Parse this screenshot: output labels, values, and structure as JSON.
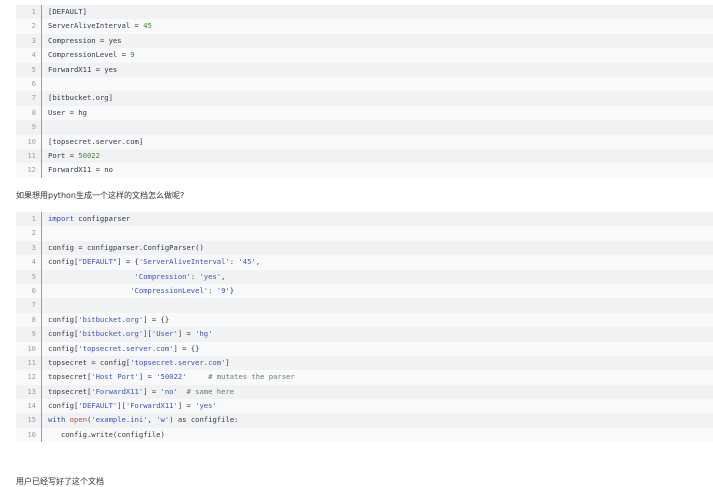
{
  "block1": {
    "lines": [
      {
        "num": "1",
        "segments": [
          {
            "t": "[DEFAULT]",
            "c": ""
          }
        ]
      },
      {
        "num": "2",
        "segments": [
          {
            "t": "ServerAliveInterval = ",
            "c": ""
          },
          {
            "t": "45",
            "c": "tok-num"
          }
        ]
      },
      {
        "num": "3",
        "segments": [
          {
            "t": "Compression = yes",
            "c": ""
          }
        ]
      },
      {
        "num": "4",
        "segments": [
          {
            "t": "CompressionLevel = ",
            "c": ""
          },
          {
            "t": "9",
            "c": "tok-num"
          }
        ]
      },
      {
        "num": "5",
        "segments": [
          {
            "t": "ForwardX11 = yes",
            "c": ""
          }
        ]
      },
      {
        "num": "6",
        "segments": [
          {
            "t": "",
            "c": ""
          }
        ]
      },
      {
        "num": "7",
        "segments": [
          {
            "t": "[bitbucket.org]",
            "c": ""
          }
        ]
      },
      {
        "num": "8",
        "segments": [
          {
            "t": "User = hg",
            "c": ""
          }
        ]
      },
      {
        "num": "9",
        "segments": [
          {
            "t": "",
            "c": ""
          }
        ]
      },
      {
        "num": "10",
        "segments": [
          {
            "t": "[topsecret.server.com]",
            "c": ""
          }
        ]
      },
      {
        "num": "11",
        "segments": [
          {
            "t": "Port = ",
            "c": ""
          },
          {
            "t": "50022",
            "c": "tok-num"
          }
        ]
      },
      {
        "num": "12",
        "segments": [
          {
            "t": "ForwardX11 = no",
            "c": ""
          }
        ]
      }
    ]
  },
  "question": "如果想用python生成一个这样的文档怎么做呢?",
  "block2": {
    "lines": [
      {
        "num": "1",
        "segments": [
          {
            "t": "import",
            "c": "tok-kw"
          },
          {
            "t": " configparser",
            "c": ""
          }
        ]
      },
      {
        "num": "2",
        "segments": [
          {
            "t": "",
            "c": ""
          }
        ]
      },
      {
        "num": "3",
        "segments": [
          {
            "t": "config = configparser.ConfigParser()",
            "c": ""
          }
        ]
      },
      {
        "num": "4",
        "segments": [
          {
            "t": "config[",
            "c": ""
          },
          {
            "t": "\"DEFAULT\"",
            "c": "tok-str2"
          },
          {
            "t": "] = {",
            "c": ""
          },
          {
            "t": "'ServerAliveInterval'",
            "c": "tok-str2"
          },
          {
            "t": ": ",
            "c": ""
          },
          {
            "t": "'45'",
            "c": "tok-str2"
          },
          {
            "t": ",",
            "c": ""
          }
        ]
      },
      {
        "num": "5",
        "segments": [
          {
            "t": "                    ",
            "c": ""
          },
          {
            "t": "'Compression'",
            "c": "tok-str2"
          },
          {
            "t": ": ",
            "c": ""
          },
          {
            "t": "'yes'",
            "c": "tok-str2"
          },
          {
            "t": ",",
            "c": ""
          }
        ]
      },
      {
        "num": "6",
        "segments": [
          {
            "t": "                   ",
            "c": ""
          },
          {
            "t": "'CompressionLevel'",
            "c": "tok-str2"
          },
          {
            "t": ": ",
            "c": ""
          },
          {
            "t": "'9'",
            "c": "tok-str2"
          },
          {
            "t": "}",
            "c": ""
          }
        ]
      },
      {
        "num": "7",
        "segments": [
          {
            "t": "",
            "c": ""
          }
        ]
      },
      {
        "num": "8",
        "segments": [
          {
            "t": "config[",
            "c": ""
          },
          {
            "t": "'bitbucket.org'",
            "c": "tok-str2"
          },
          {
            "t": "] = {}",
            "c": ""
          }
        ]
      },
      {
        "num": "9",
        "segments": [
          {
            "t": "config[",
            "c": ""
          },
          {
            "t": "'bitbucket.org'",
            "c": "tok-str2"
          },
          {
            "t": "][",
            "c": ""
          },
          {
            "t": "'User'",
            "c": "tok-str2"
          },
          {
            "t": "] = ",
            "c": ""
          },
          {
            "t": "'hg'",
            "c": "tok-str2"
          }
        ]
      },
      {
        "num": "10",
        "segments": [
          {
            "t": "config[",
            "c": ""
          },
          {
            "t": "'topsecret.server.com'",
            "c": "tok-str2"
          },
          {
            "t": "] = {}",
            "c": ""
          }
        ]
      },
      {
        "num": "11",
        "segments": [
          {
            "t": "topsecret = config[",
            "c": ""
          },
          {
            "t": "'topsecret.server.com'",
            "c": "tok-str2"
          },
          {
            "t": "]",
            "c": ""
          }
        ]
      },
      {
        "num": "12",
        "segments": [
          {
            "t": "topsecret[",
            "c": ""
          },
          {
            "t": "'Host Port'",
            "c": "tok-str2"
          },
          {
            "t": "] = ",
            "c": ""
          },
          {
            "t": "'50022'",
            "c": "tok-str2"
          },
          {
            "t": "     ",
            "c": ""
          },
          {
            "t": "# mutates the parser",
            "c": "tok-comment"
          }
        ]
      },
      {
        "num": "13",
        "segments": [
          {
            "t": "topsecret[",
            "c": ""
          },
          {
            "t": "'ForwardX11'",
            "c": "tok-str2"
          },
          {
            "t": "] = ",
            "c": ""
          },
          {
            "t": "'no'",
            "c": "tok-str2"
          },
          {
            "t": "  ",
            "c": ""
          },
          {
            "t": "# same here",
            "c": "tok-comment"
          }
        ]
      },
      {
        "num": "14",
        "segments": [
          {
            "t": "config[",
            "c": ""
          },
          {
            "t": "'DEFAULT'",
            "c": "tok-str2"
          },
          {
            "t": "][",
            "c": ""
          },
          {
            "t": "'ForwardX11'",
            "c": "tok-str2"
          },
          {
            "t": "] = ",
            "c": ""
          },
          {
            "t": "'yes'",
            "c": "tok-str2"
          }
        ]
      },
      {
        "num": "15",
        "segments": [
          {
            "t": "with",
            "c": "tok-kw"
          },
          {
            "t": " ",
            "c": ""
          },
          {
            "t": "open",
            "c": "tok-builtin"
          },
          {
            "t": "(",
            "c": ""
          },
          {
            "t": "'example.ini'",
            "c": "tok-str2"
          },
          {
            "t": ", ",
            "c": ""
          },
          {
            "t": "'w'",
            "c": "tok-str2"
          },
          {
            "t": ") as configfile:",
            "c": ""
          }
        ]
      },
      {
        "num": "16",
        "segments": [
          {
            "t": "   config.write(configfile)",
            "c": ""
          }
        ]
      }
    ]
  },
  "footer_text": "用户已经写好了这个文档"
}
